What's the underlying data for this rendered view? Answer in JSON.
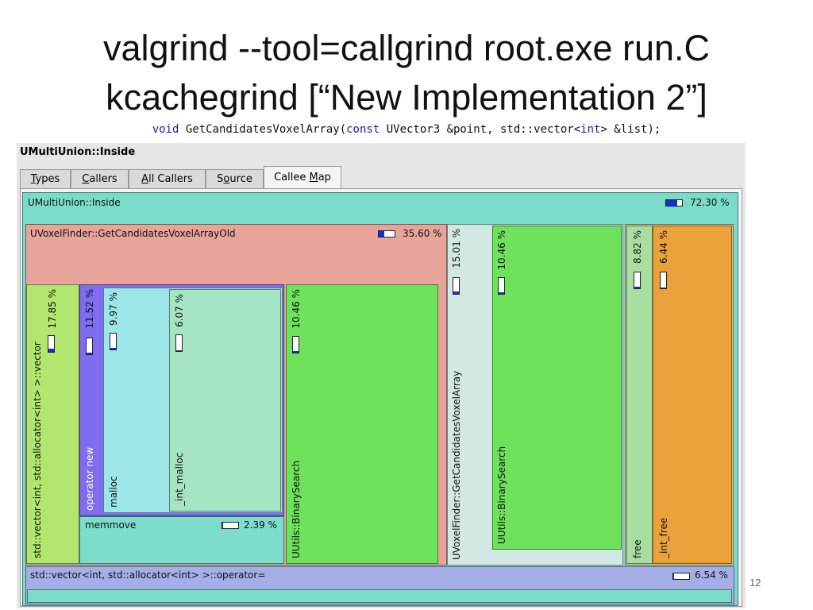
{
  "slide": {
    "title_line1": "valgrind --tool=callgrind root.exe run.C",
    "title_line2": "kcachegrind [“New Implementation 2”]",
    "code": {
      "kw1": "void",
      "part1": " GetCandidatesVoxelArray(",
      "kw2": "const",
      "part2": " UVector3 &point, std::vector<",
      "kw3": "int",
      "part3": "> &list);"
    },
    "page_number": "12"
  },
  "window": {
    "title": "UMultiUnion::Inside",
    "tabs": [
      {
        "pre": "",
        "ul": "T",
        "post": "ypes"
      },
      {
        "pre": "",
        "ul": "C",
        "post": "allers"
      },
      {
        "pre": "",
        "ul": "A",
        "post": "ll Callers"
      },
      {
        "pre": "S",
        "ul": "o",
        "post": "urce"
      },
      {
        "pre": "Callee ",
        "ul": "M",
        "post": "ap"
      }
    ],
    "active_tab": 4
  },
  "callee_map": {
    "root": {
      "name": "UMultiUnion::Inside",
      "percent": "72.30 %",
      "fraction": 0.723
    },
    "old": {
      "name": "UVoxelFinder::GetCandidatesVoxelArrayOld",
      "percent": "35.60 %",
      "fraction": 0.356
    },
    "vector": {
      "name": "std::vector<int, std::allocator<int> >::vector",
      "percent": "17.85 %",
      "fraction": 0.1785
    },
    "op_new": {
      "name": "operator new",
      "percent": "11.52 %",
      "fraction": 0.1152
    },
    "malloc": {
      "name": "malloc",
      "percent": "9.97 %",
      "fraction": 0.0997
    },
    "int_malloc": {
      "name": "_int_malloc",
      "percent": "6.07 %",
      "fraction": 0.0607
    },
    "memmove": {
      "name": "memmove",
      "percent": "2.39 %",
      "fraction": 0.0239
    },
    "bs1": {
      "name": "UUtils::BinarySearch",
      "percent": "10.46 %",
      "fraction": 0.1046
    },
    "gcva": {
      "name": "UVoxelFinder::GetCandidatesVoxelArray",
      "percent": "15.01 %",
      "fraction": 0.1501
    },
    "bs2": {
      "name": "UUtils::BinarySearch",
      "percent": "10.46 %",
      "fraction": 0.1046
    },
    "free": {
      "name": "free",
      "percent": "8.82 %",
      "fraction": 0.0882
    },
    "int_free": {
      "name": "_int_free",
      "percent": "6.44 %",
      "fraction": 0.0644
    },
    "op_assign": {
      "name": "std::vector<int, std::allocator<int> >::operator=",
      "percent": "6.54 %",
      "fraction": 0.0654
    }
  },
  "colors": {
    "root": "#79dcc8",
    "old": "#e8a39a",
    "vector": "#b2e66e",
    "op_new": "#7f6cf0",
    "malloc": "#9de6e8",
    "int_malloc": "#a6e4c6",
    "memmove": "#7bddca",
    "bs": "#6ee25a",
    "gcva": "#d2e8e2",
    "free_parent": "#e0c28c",
    "free": "#a8dfa0",
    "int_free": "#eba23a",
    "op_assign": "#a6aee8",
    "op_assign_inner": "#7ddcc8",
    "bar_fill": "#1230d8"
  }
}
